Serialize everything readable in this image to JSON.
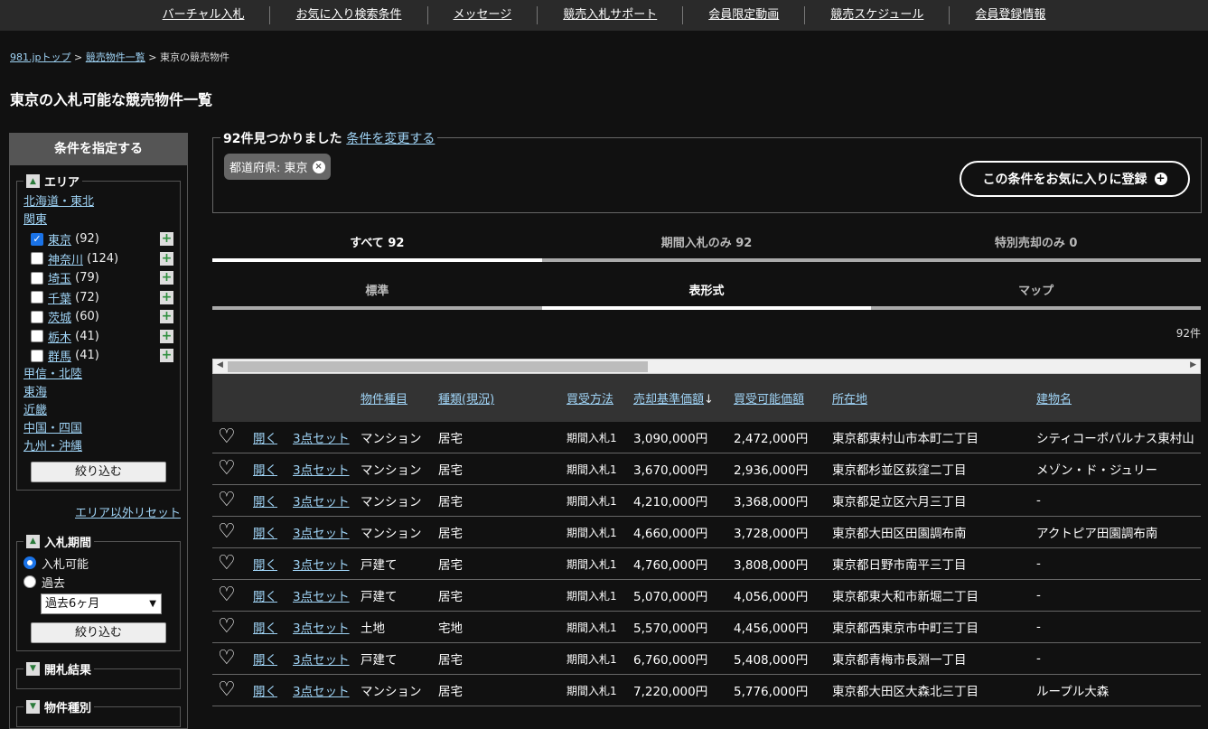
{
  "topnav": [
    "バーチャル入札",
    "お気に入り検索条件",
    "メッセージ",
    "競売入札サポート",
    "会員限定動画",
    "競売スケジュール",
    "会員登録情報"
  ],
  "breadcrumb": {
    "home": "981.jpトップ",
    "list": "競売物件一覧",
    "current": "東京の競売物件"
  },
  "page_title": "東京の入札可能な競売物件一覧",
  "sidebar": {
    "title": "条件を指定する",
    "area_label": "エリア",
    "regions_top": [
      "北海道・東北",
      "関東"
    ],
    "prefs": [
      {
        "name": "東京",
        "count": "(92)",
        "checked": true
      },
      {
        "name": "神奈川",
        "count": "(124)",
        "checked": false
      },
      {
        "name": "埼玉",
        "count": "(79)",
        "checked": false
      },
      {
        "name": "千葉",
        "count": "(72)",
        "checked": false
      },
      {
        "name": "茨城",
        "count": "(60)",
        "checked": false
      },
      {
        "name": "栃木",
        "count": "(41)",
        "checked": false
      },
      {
        "name": "群馬",
        "count": "(41)",
        "checked": false
      }
    ],
    "regions_bottom": [
      "甲信・北陸",
      "東海",
      "近畿",
      "中国・四国",
      "九州・沖縄"
    ],
    "filter_btn": "絞り込む",
    "reset_link": "エリア以外リセット",
    "period_label": "入札期間",
    "radio_available": "入札可能",
    "radio_past": "過去",
    "past_select": "過去6ヶ月",
    "result_label": "開札結果",
    "type_label": "物件種別"
  },
  "found": {
    "text": "92件見つかりました",
    "change_link": "条件を変更する",
    "chip": "都道府県: 東京",
    "fav_btn": "この条件をお気に入りに登録"
  },
  "tabs1": [
    "すべて 92",
    "期間入札のみ 92",
    "特別売却のみ 0"
  ],
  "tabs2": [
    "標準",
    "表形式",
    "マップ"
  ],
  "count": "92件",
  "headers": {
    "type": "物件種目",
    "kind": "種類(現況)",
    "method": "買受方法",
    "base": "売却基準価額",
    "possible": "買受可能価額",
    "location": "所在地",
    "building": "建物名"
  },
  "rows": [
    {
      "open": "開く",
      "set": "3点セット",
      "type": "マンション",
      "kind": "居宅",
      "method": "期間入札1",
      "base": "3,090,000円",
      "possible": "2,472,000円",
      "location": "東京都東村山市本町二丁目",
      "building": "シティコーポパルナス東村山"
    },
    {
      "open": "開く",
      "set": "3点セット",
      "type": "マンション",
      "kind": "居宅",
      "method": "期間入札1",
      "base": "3,670,000円",
      "possible": "2,936,000円",
      "location": "東京都杉並区荻窪二丁目",
      "building": "メゾン・ド・ジュリー"
    },
    {
      "open": "開く",
      "set": "3点セット",
      "type": "マンション",
      "kind": "居宅",
      "method": "期間入札1",
      "base": "4,210,000円",
      "possible": "3,368,000円",
      "location": "東京都足立区六月三丁目",
      "building": "-"
    },
    {
      "open": "開く",
      "set": "3点セット",
      "type": "マンション",
      "kind": "居宅",
      "method": "期間入札1",
      "base": "4,660,000円",
      "possible": "3,728,000円",
      "location": "東京都大田区田園調布南",
      "building": "アクトピア田園調布南"
    },
    {
      "open": "開く",
      "set": "3点セット",
      "type": "戸建て",
      "kind": "居宅",
      "method": "期間入札1",
      "base": "4,760,000円",
      "possible": "3,808,000円",
      "location": "東京都日野市南平三丁目",
      "building": "-"
    },
    {
      "open": "開く",
      "set": "3点セット",
      "type": "戸建て",
      "kind": "居宅",
      "method": "期間入札1",
      "base": "5,070,000円",
      "possible": "4,056,000円",
      "location": "東京都東大和市新堀二丁目",
      "building": "-"
    },
    {
      "open": "開く",
      "set": "3点セット",
      "type": "土地",
      "kind": "宅地",
      "method": "期間入札1",
      "base": "5,570,000円",
      "possible": "4,456,000円",
      "location": "東京都西東京市中町三丁目",
      "building": "-"
    },
    {
      "open": "開く",
      "set": "3点セット",
      "type": "戸建て",
      "kind": "居宅",
      "method": "期間入札1",
      "base": "6,760,000円",
      "possible": "5,408,000円",
      "location": "東京都青梅市長淵一丁目",
      "building": "-"
    },
    {
      "open": "開く",
      "set": "3点セット",
      "type": "マンション",
      "kind": "居宅",
      "method": "期間入札1",
      "base": "7,220,000円",
      "possible": "5,776,000円",
      "location": "東京都大田区大森北三丁目",
      "building": "ループル大森"
    }
  ]
}
